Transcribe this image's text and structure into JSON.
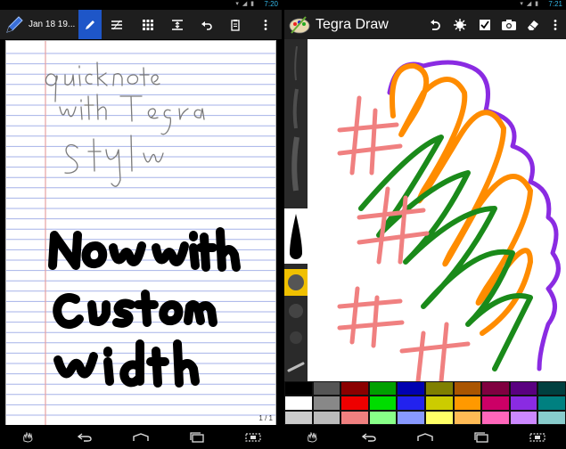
{
  "left_app": {
    "status_time": "7:20",
    "date_label": "Jan 18 19...",
    "page_indicator": "1 / 1",
    "handwriting": {
      "note_lines": [
        "quick note",
        "with Tegra",
        "Stylo"
      ],
      "bold_lines": [
        "Now with",
        "Custom",
        "Width"
      ]
    }
  },
  "right_app": {
    "status_time": "7:21",
    "app_title": "Tegra Draw"
  },
  "palette": {
    "row1": [
      "#000000",
      "#555555",
      "#8b0000",
      "#00a000",
      "#0000b0",
      "#808000",
      "#aa5500",
      "#800040",
      "#5a0080",
      "#004040"
    ],
    "row2": [
      "#ffffff",
      "#888888",
      "#ee0000",
      "#00dd00",
      "#2222ee",
      "#cccc00",
      "#ff9900",
      "#cc0066",
      "#8a2be2",
      "#008080"
    ],
    "row3": [
      "#cccccc",
      "#bbbbbb",
      "#f08080",
      "#88ff88",
      "#8899ff",
      "#ffff66",
      "#ffbb55",
      "#ff66bb",
      "#cc88ff",
      "#88cccc"
    ]
  },
  "colors": {
    "accent": "#33b5e5",
    "selected_tool": "#1e56c8",
    "margin_line": "#e7a0a0",
    "rule_line": "#a6b2e8",
    "purple_stroke": "#8a2be2",
    "orange_stroke": "#ff8c00",
    "green_stroke": "#1a8a1a",
    "pink_stroke": "#f08080"
  }
}
